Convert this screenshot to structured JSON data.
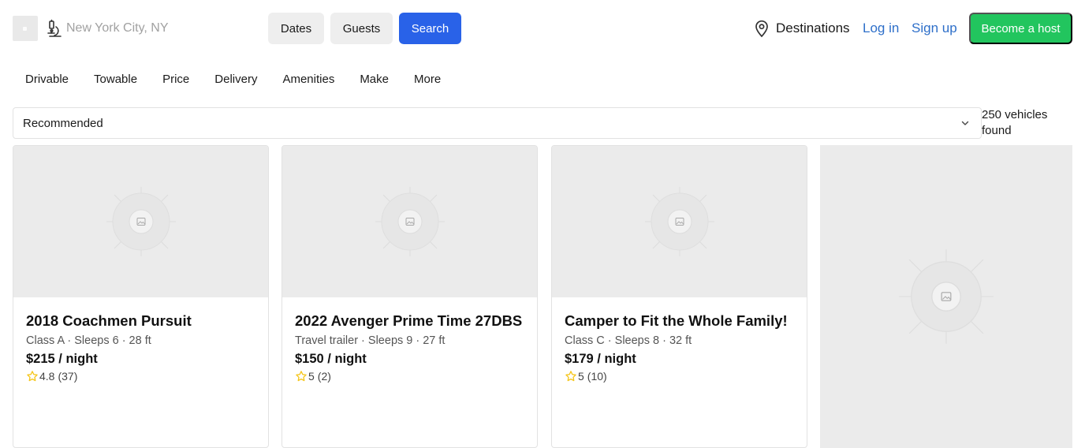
{
  "header": {
    "search_placeholder": "New York City, NY",
    "dates_label": "Dates",
    "guests_label": "Guests",
    "search_label": "Search",
    "destinations_label": "Destinations",
    "login_label": "Log in",
    "signup_label": "Sign up",
    "host_label": "Become a host"
  },
  "filters": [
    "Drivable",
    "Towable",
    "Price",
    "Delivery",
    "Amenities",
    "Make",
    "More"
  ],
  "sort": {
    "selected": "Recommended"
  },
  "results": {
    "count_text": "250 vehicles found"
  },
  "listings": [
    {
      "title": "2018 Coachmen Pursuit",
      "subtitle": "Class A · Sleeps 6 · 28 ft",
      "price": "$215 / night",
      "rating": "4.8",
      "reviews": "(37)"
    },
    {
      "title": "2022 Avenger Prime Time 27DBS",
      "subtitle": "Travel trailer · Sleeps 9 · 27 ft",
      "price": "$150 / night",
      "rating": "5",
      "reviews": "(2)"
    },
    {
      "title": "Camper to Fit the Whole Family!",
      "subtitle": "Class C · Sleeps 8 · 32 ft",
      "price": "$179 / night",
      "rating": "5",
      "reviews": "(10)"
    }
  ],
  "colors": {
    "primary_blue": "#2962e8",
    "link_blue": "#2e6fc9",
    "host_green": "#22c55e",
    "star_gold": "#f5c518"
  },
  "icons": {
    "location": "location-pin-icon",
    "search_field": "microscope-icon",
    "chevron": "chevron-down-icon",
    "star": "star-icon",
    "image_placeholder": "image-placeholder-icon"
  }
}
